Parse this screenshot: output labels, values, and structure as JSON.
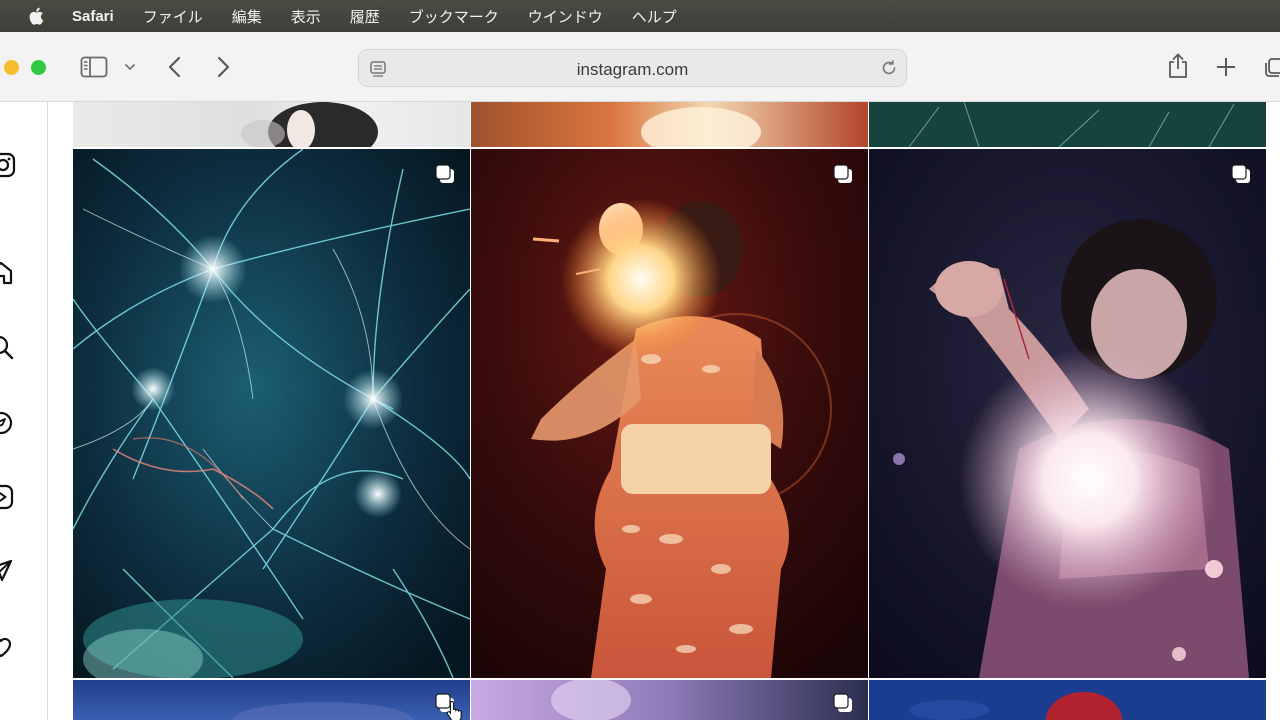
{
  "menubar": {
    "app_name": "Safari",
    "items": [
      "ファイル",
      "編集",
      "表示",
      "履歴",
      "ブックマーク",
      "ウインドウ",
      "ヘルプ"
    ]
  },
  "browser": {
    "url": "instagram.com"
  },
  "icons": {
    "menubar": "apple-logo-icon",
    "toolbar": [
      "sidebar-toggle-icon",
      "chevron-down-icon",
      "back-icon",
      "forward-icon",
      "reader-icon",
      "reload-icon",
      "share-icon",
      "new-tab-icon",
      "tab-overview-icon"
    ],
    "rail": [
      "instagram-logo-icon",
      "home-icon",
      "search-icon",
      "explore-icon",
      "reels-icon",
      "messages-icon",
      "notifications-icon"
    ],
    "post_badge": "multiple-images-icon"
  },
  "colors": {
    "menubar_bg": "#3d3f38",
    "toolbar_bg": "#f3f3f3",
    "traffic_yellow": "#f6bd2e",
    "traffic_green": "#2fc840"
  },
  "posts": [
    {
      "row": 0,
      "col": 0,
      "subject": "woman portrait top crop",
      "multi": false
    },
    {
      "row": 0,
      "col": 1,
      "subject": "warm light top crop",
      "multi": false
    },
    {
      "row": 0,
      "col": 2,
      "subject": "green sparks top crop",
      "multi": false
    },
    {
      "row": 1,
      "col": 0,
      "subject": "teal fireworks",
      "multi": true
    },
    {
      "row": 1,
      "col": 1,
      "subject": "woman in yukata holding sparkler",
      "multi": true
    },
    {
      "row": 1,
      "col": 2,
      "subject": "woman with glowing sparkler at night",
      "multi": true
    },
    {
      "row": 2,
      "col": 0,
      "subject": "blue dusk",
      "multi": true
    },
    {
      "row": 2,
      "col": 1,
      "subject": "lavender scene",
      "multi": true
    },
    {
      "row": 2,
      "col": 2,
      "subject": "blue with red figure",
      "multi": false
    }
  ]
}
